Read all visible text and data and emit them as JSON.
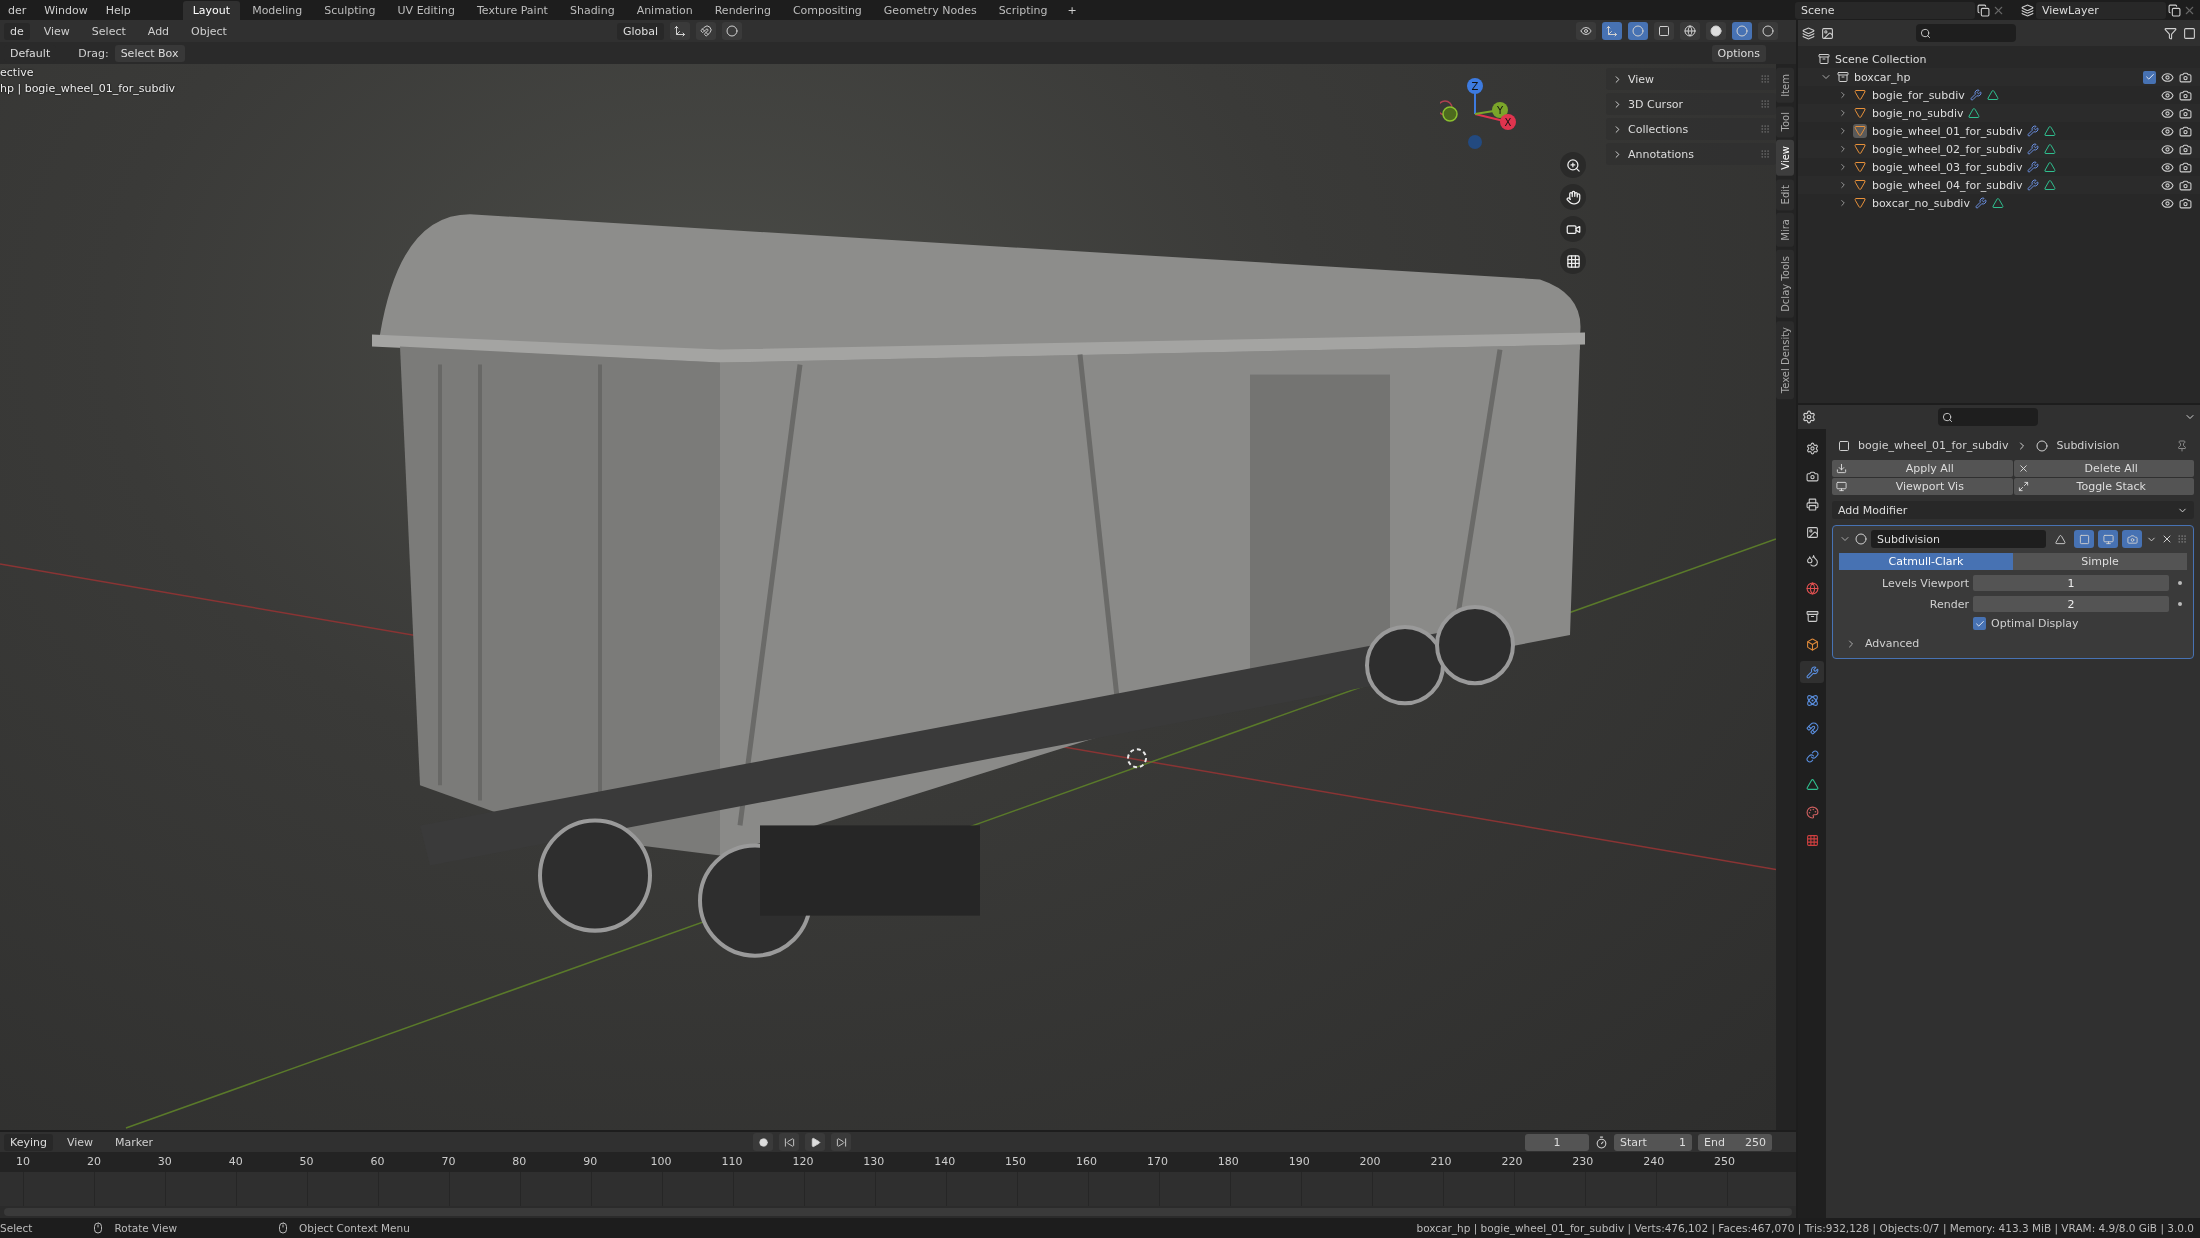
{
  "top_bar": {
    "menus": [
      "der",
      "Window",
      "Help"
    ],
    "workspaces": [
      {
        "label": "Layout",
        "selected": true
      },
      {
        "label": "Modeling",
        "selected": false
      },
      {
        "label": "Sculpting",
        "selected": false
      },
      {
        "label": "UV Editing",
        "selected": false
      },
      {
        "label": "Texture Paint",
        "selected": false
      },
      {
        "label": "Shading",
        "selected": false
      },
      {
        "label": "Animation",
        "selected": false
      },
      {
        "label": "Rendering",
        "selected": false
      },
      {
        "label": "Compositing",
        "selected": false
      },
      {
        "label": "Geometry Nodes",
        "selected": false
      },
      {
        "label": "Scripting",
        "selected": false
      }
    ],
    "add_workspace": "+",
    "scene": "Scene",
    "view_layer": "ViewLayer"
  },
  "viewport_header": {
    "mode": "de",
    "menus": [
      "View",
      "Select",
      "Add",
      "Object"
    ],
    "orientation": "Global",
    "options": "Options"
  },
  "tool_settings": {
    "orientation": "Default",
    "drag_label": "Drag:",
    "drag_value": "Select Box"
  },
  "viewport": {
    "overlay_lines": [
      "ective",
      "hp | bogie_wheel_01_for_subdiv"
    ],
    "gizmo_axes": [
      "Z",
      "Y",
      "X"
    ],
    "sidebar_panels": [
      {
        "label": "View",
        "expanded": false
      },
      {
        "label": "3D Cursor",
        "expanded": false
      },
      {
        "label": "Collections",
        "expanded": false
      },
      {
        "label": "Annotations",
        "expanded": false
      }
    ],
    "sidebar_tabs": [
      {
        "label": "Item",
        "selected": false
      },
      {
        "label": "Tool",
        "selected": false
      },
      {
        "label": "View",
        "selected": true
      },
      {
        "label": "Edit",
        "selected": false
      },
      {
        "label": "Mira",
        "selected": false
      },
      {
        "label": "Dclay Tools",
        "selected": false
      },
      {
        "label": "Texel Density",
        "selected": false
      }
    ]
  },
  "outliner": {
    "root": "Scene Collection",
    "collections": [
      {
        "name": "boxcar_hp",
        "expanded": true,
        "checked": true,
        "children": [
          {
            "name": "bogie_for_subdiv",
            "selected": false,
            "has_modifier": true
          },
          {
            "name": "bogie_no_subdiv",
            "selected": false,
            "has_modifier": false
          },
          {
            "name": "bogie_wheel_01_for_subdiv",
            "selected": true,
            "has_modifier": true
          },
          {
            "name": "bogie_wheel_02_for_subdiv",
            "selected": false,
            "has_modifier": true
          },
          {
            "name": "bogie_wheel_03_for_subdiv",
            "selected": false,
            "has_modifier": true
          },
          {
            "name": "bogie_wheel_04_for_subdiv",
            "selected": false,
            "has_modifier": true
          },
          {
            "name": "boxcar_no_subdiv",
            "selected": false,
            "has_modifier": true
          }
        ]
      }
    ]
  },
  "properties": {
    "breadcrumb": [
      "bogie_wheel_01_for_subdiv",
      "Subdivision"
    ],
    "tabs": [
      {
        "selected": false
      },
      {
        "selected": false
      },
      {
        "selected": false
      },
      {
        "selected": false
      },
      {
        "selected": false
      },
      {
        "selected": false
      },
      {
        "selected": false
      },
      {
        "selected": false
      },
      {
        "selected": true
      },
      {
        "selected": false
      },
      {
        "selected": false
      },
      {
        "selected": false
      },
      {
        "selected": false
      },
      {
        "selected": false
      },
      {
        "selected": false
      }
    ],
    "buttons": [
      "Apply All",
      "Delete All",
      "Viewport Vis",
      "Toggle Stack"
    ],
    "add_modifier": "Add Modifier",
    "modifier": {
      "name": "Subdivision",
      "expanded": true,
      "types": [
        {
          "label": "Catmull-Clark",
          "selected": true
        },
        {
          "label": "Simple",
          "selected": false
        }
      ],
      "fields": [
        {
          "label": "Levels Viewport",
          "value": "1"
        },
        {
          "label": "Render",
          "value": "2"
        }
      ],
      "optimal_display": {
        "label": "Optimal Display",
        "checked": true
      },
      "advanced": {
        "label": "Advanced",
        "expanded": false
      }
    }
  },
  "timeline": {
    "menus": [
      "Keying",
      "View",
      "Marker"
    ],
    "current_frame": "1",
    "start_label": "Start",
    "start": "1",
    "end_label": "End",
    "end": "250",
    "ticks": [
      "10",
      "20",
      "30",
      "40",
      "50",
      "60",
      "70",
      "80",
      "90",
      "100",
      "110",
      "120",
      "130",
      "140",
      "150",
      "160",
      "170",
      "180",
      "190",
      "200",
      "210",
      "220",
      "230",
      "240",
      "250"
    ]
  },
  "status_bar": {
    "hints": [
      "Select",
      "Rotate View",
      "Object Context Menu"
    ],
    "stats": "boxcar_hp | bogie_wheel_01_for_subdiv | Verts:476,102 | Faces:467,070 | Tris:932,128 | Objects:0/7 | Memory: 413.3 MiB | VRAM: 4.9/8.0 GiB | 3.0.0"
  }
}
